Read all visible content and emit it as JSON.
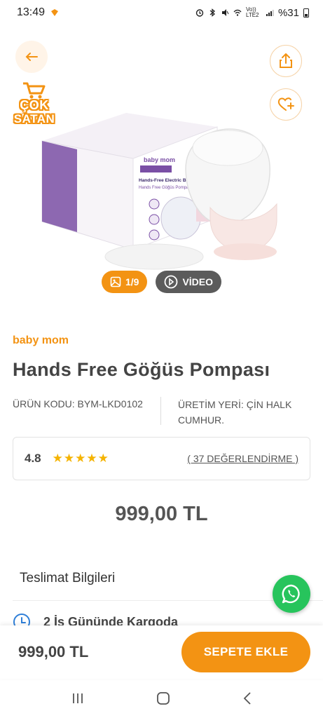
{
  "status_bar": {
    "time": "13:49",
    "network": "Vo)) LTE2",
    "battery": "%31"
  },
  "hero": {
    "badge_line1": "ÇOK",
    "badge_line2": "SATAN",
    "photo_counter": "1/9",
    "video_label": "VİDEO",
    "box_brand": "baby mom",
    "box_title": "Hands-Free Electric Breast Pump",
    "box_subtitle": "Hands Free Göğüs Pompası"
  },
  "product": {
    "brand": "baby mom",
    "title": "Hands Free Göğüs Pompası",
    "code": "ÜRÜN KODU: BYM-LKD0102",
    "origin": "ÜRETİM YERİ: ÇİN HALK CUMHUR.",
    "rating": "4.8",
    "stars": "★★★★★",
    "reviews": "( 37 DEĞERLENDİRME )",
    "price": "999,00 TL"
  },
  "delivery": {
    "title": "Teslimat Bilgileri",
    "row1": "2 İş Gününde Kargoda"
  },
  "bottom_bar": {
    "price": "999,00 TL",
    "add_to_cart": "SEPETE EKLE"
  },
  "colors": {
    "accent": "#f39313",
    "whatsapp": "#27c45c",
    "star": "#f5b301"
  }
}
